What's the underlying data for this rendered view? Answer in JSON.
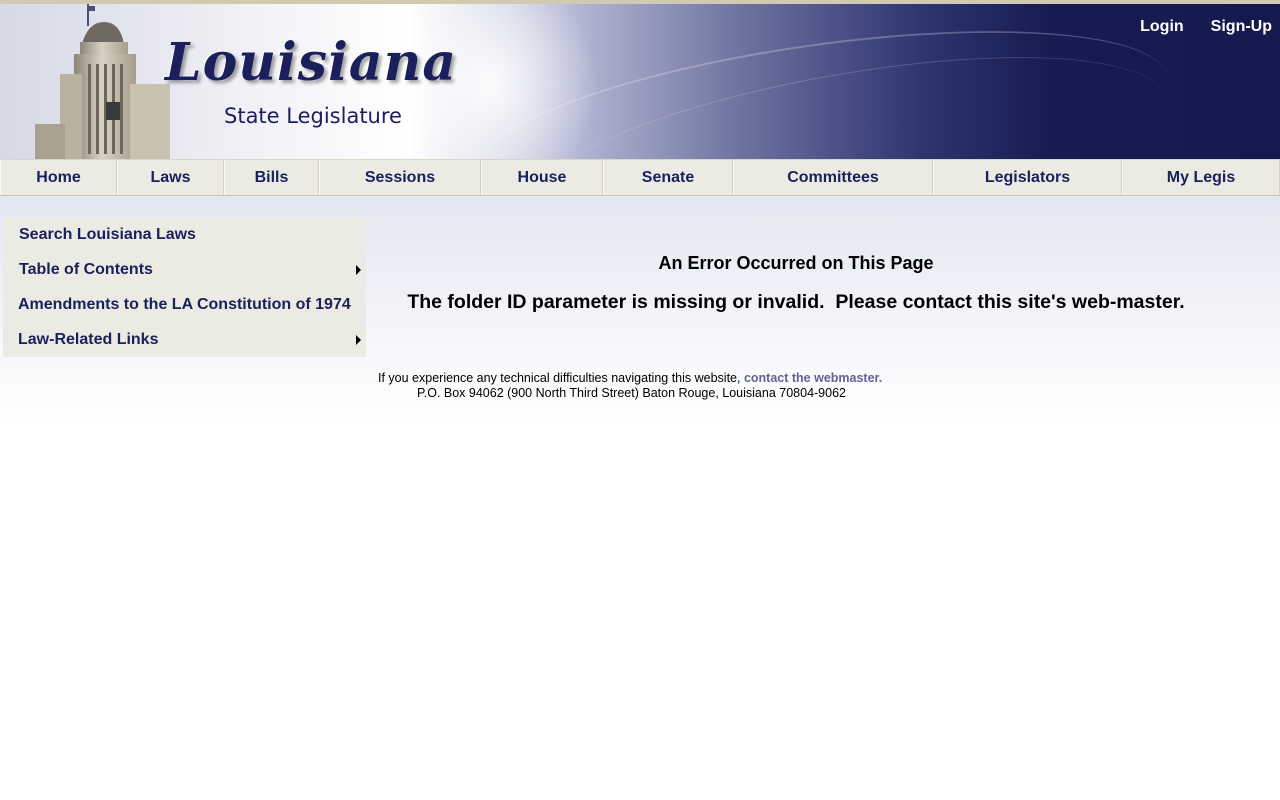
{
  "header": {
    "logo_title": "Louisiana",
    "logo_subtitle": "State Legislature",
    "links": {
      "login": "Login",
      "signup": "Sign-Up"
    }
  },
  "nav": {
    "items": [
      "Home",
      "Laws",
      "Bills",
      "Sessions",
      "House",
      "Senate",
      "Committees",
      "Legislators",
      "My Legis"
    ]
  },
  "sidebar": {
    "items": [
      {
        "label": "Search Louisiana Laws",
        "has_submenu": false
      },
      {
        "label": "Table of Contents",
        "has_submenu": true
      },
      {
        "label": "Amendments to the LA Constitution of 1974",
        "has_submenu": false
      },
      {
        "label": "Law-Related Links",
        "has_submenu": true
      }
    ]
  },
  "error": {
    "title": "An Error Occurred on This Page",
    "message": "The folder ID parameter is missing or invalid.  Please contact this site's web-master."
  },
  "footer": {
    "difficulty_text": "If you experience any technical difficulties navigating this website, ",
    "webmaster_link": "contact the webmaster.",
    "address": "P.O. Box 94062 (900 North Third Street) Baton Rouge, Louisiana 70804-9062"
  },
  "colors": {
    "brand_navy": "#1b1f5c",
    "nav_bg": "#ecebe3",
    "link": "#5f6495"
  }
}
